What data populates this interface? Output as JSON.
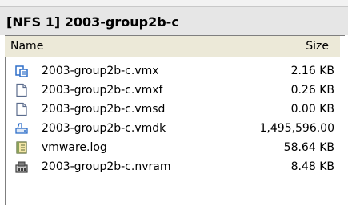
{
  "window": {
    "title": "[NFS 1] 2003-group2b-c"
  },
  "columns": {
    "name": "Name",
    "size": "Size"
  },
  "files": [
    {
      "name": "2003-group2b-c.vmx",
      "size": "2.16 KB",
      "icon": "vm-config-icon"
    },
    {
      "name": "2003-group2b-c.vmxf",
      "size": "0.26 KB",
      "icon": "blank-file-icon"
    },
    {
      "name": "2003-group2b-c.vmsd",
      "size": "0.00 KB",
      "icon": "blank-file-icon"
    },
    {
      "name": "2003-group2b-c.vmdk",
      "size": "1,495,596.00",
      "icon": "virtual-disk-icon"
    },
    {
      "name": "vmware.log",
      "size": "58.64 KB",
      "icon": "log-file-icon"
    },
    {
      "name": "2003-group2b-c.nvram",
      "size": "8.48 KB",
      "icon": "nvram-icon"
    }
  ],
  "colors": {
    "title_bar": "#e6e6e6",
    "header": "#ece9d8",
    "icon_blue": "#2f6fc9"
  }
}
